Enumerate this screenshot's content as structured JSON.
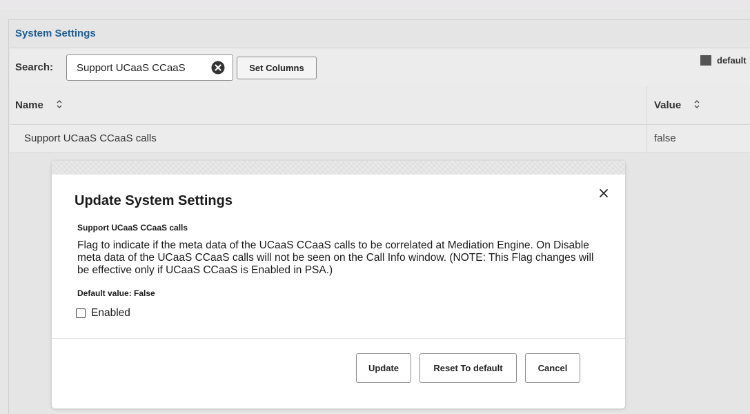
{
  "panel": {
    "title": "System Settings"
  },
  "search": {
    "label": "Search:",
    "value": "Support UCaaS CCaaS",
    "set_columns_label": "Set Columns",
    "legend_label": "default"
  },
  "table": {
    "columns": [
      "Name",
      "Value"
    ],
    "rows": [
      {
        "name": "Support UCaaS CCaaS calls",
        "value": "false"
      }
    ]
  },
  "modal": {
    "title": "Update System Settings",
    "setting_name": "Support UCaaS CCaaS calls",
    "description": "Flag to indicate if the meta data of the UCaaS CCaaS calls to be correlated at Mediation Engine. On Disable meta data of the UCaaS CCaaS calls will not be seen on the Call Info window. (NOTE: This Flag changes will be effective only if UCaaS CCaaS is Enabled in PSA.)",
    "default_value": "Default value: False",
    "checkbox_label": "Enabled",
    "checkbox_checked": false,
    "buttons": {
      "update": "Update",
      "reset": "Reset To default",
      "cancel": "Cancel"
    }
  },
  "icons": {
    "clear": "close-circle-icon",
    "sort": "sort-icon",
    "close": "close-icon"
  },
  "colors": {
    "title_blue": "#1f5d93",
    "legend_swatch": "#555555",
    "background": "#e6e6e6"
  }
}
